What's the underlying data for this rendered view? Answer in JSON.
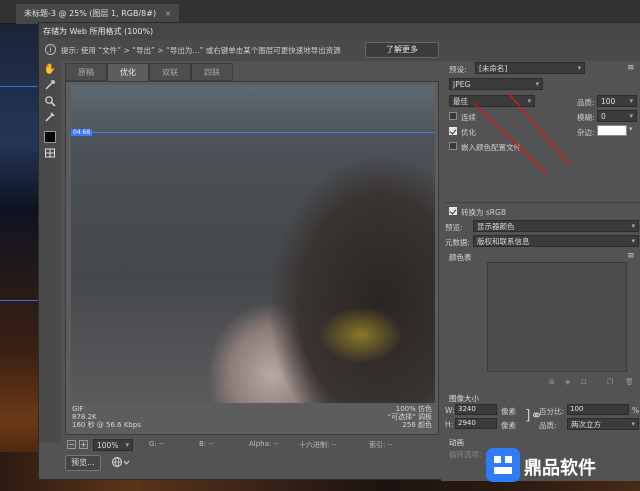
{
  "doc_tab": {
    "title": "未标题-3 @ 25% (图层 1, RGB/8#)",
    "close": "×"
  },
  "dialog": {
    "title": "存储为 Web 所用格式 (100%)",
    "tip": "提示: 使用 “文件” > “导出” > “导出为...” 或右键单击某个图层可更快速地导出资源",
    "learn_more": "了解更多"
  },
  "tools": [
    "hand-icon",
    "slice-select-icon",
    "zoom-icon",
    "eyedropper-icon",
    "eyedropper-color-icon",
    "toggle-slices-icon"
  ],
  "tabs": [
    "原稿",
    "优化",
    "双联",
    "四联"
  ],
  "active_tab": "优化",
  "preview": {
    "guide_label": "04 68",
    "left_info": [
      "GIF",
      "878.2K",
      "160 秒 @ 56.6 Kbps"
    ],
    "right_info": [
      "100% 仿色",
      "“可选择” 调板",
      "256 颜色"
    ]
  },
  "status": {
    "zoom": "100%",
    "g": "G: --",
    "b": "B: --",
    "alpha": "Alpha: --",
    "hex": "十六进制: --",
    "index": "索引: --"
  },
  "footer": {
    "preview": "预览...",
    "browser_icon": "globe-icon"
  },
  "settings": {
    "preset_label": "预设:",
    "preset_value": "[未命名]",
    "format": "JPEG",
    "quality_level": "最佳",
    "quality_label": "品质:",
    "quality_value": "100",
    "progressive_label": "连续",
    "progressive_checked": false,
    "blur_label": "模糊:",
    "blur_value": "0",
    "optimized_label": "优化",
    "optimized_checked": true,
    "matte_label": "杂边:",
    "embed_profile_label": "嵌入颜色配置文件",
    "embed_profile_checked": false,
    "convert_srgb_label": "转换为 sRGB",
    "convert_srgb_checked": true,
    "preview_label": "预览:",
    "preview_value": "显示器颜色",
    "metadata_label": "元数据:",
    "metadata_value": "版权和联系信息",
    "color_table_label": "颜色表",
    "image_size_label": "图像大小",
    "w_label": "W:",
    "w_value": "3240",
    "h_label": "H:",
    "h_value": "2940",
    "unit": "像素",
    "percent_label": "百分比:",
    "percent_value": "100",
    "percent_unit": "%",
    "quality2_label": "品质:",
    "quality2_value": "两次立方",
    "animation_label": "动画",
    "loop_label": "循环选项:",
    "loop_value": "永远"
  },
  "colors": {
    "accent_blue": "#3b78ff",
    "arrow_red": "#d11a1a"
  },
  "watermark": {
    "text": "鼎品软件"
  }
}
